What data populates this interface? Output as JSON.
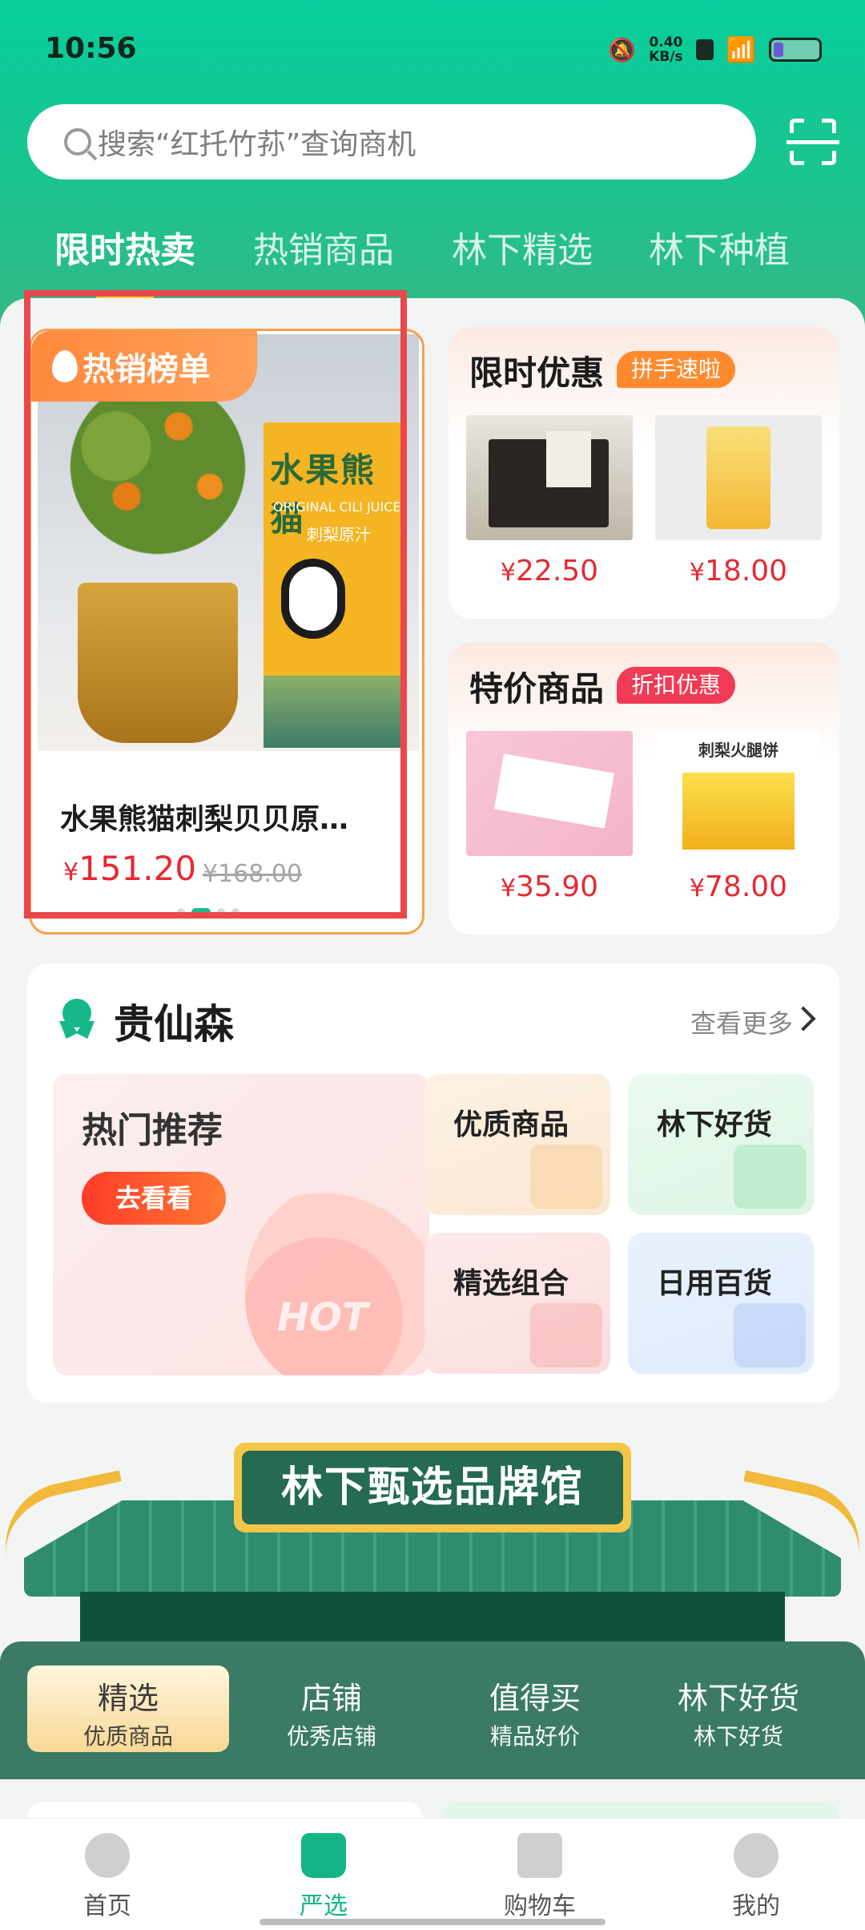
{
  "status_bar": {
    "time": "10:56",
    "speed_value": "0.40",
    "speed_unit": "KB/s"
  },
  "search": {
    "placeholder": "搜索“红托竹荪”查询商机"
  },
  "tabs": [
    {
      "label": "限时热卖",
      "active": true
    },
    {
      "label": "热销商品",
      "active": false
    },
    {
      "label": "林下精选",
      "active": false
    },
    {
      "label": "林下种植",
      "active": false
    }
  ],
  "hot_card": {
    "ribbon": "热销榜单",
    "product_box_title": "水果熊猫",
    "product_box_subtitle": "ORIGINAL CILI JUICE",
    "product_box_subtitle2": "刺梨原汁",
    "name": "水果熊猫刺梨贝贝原…",
    "currency": "¥",
    "price": "151.20",
    "original_price": "¥168.00",
    "carousel_page": 2,
    "carousel_total": 4
  },
  "promo_limited": {
    "title": "限时优惠",
    "tag": "拼手速啦",
    "items": [
      {
        "price": "22.50"
      },
      {
        "price": "18.00"
      }
    ]
  },
  "promo_special": {
    "title": "特价商品",
    "tag": "折扣优惠",
    "items": [
      {
        "price": "35.90"
      },
      {
        "price": "78.00"
      }
    ]
  },
  "guixiansen": {
    "title": "贵仙森",
    "more": "查看更多",
    "hot_recommend": {
      "title": "热门推荐",
      "button": "去看看",
      "deco_text": "HOT"
    },
    "cells": [
      "优质商品",
      "林下好货",
      "精选组合",
      "日用百货"
    ]
  },
  "brand_hall": {
    "title": "林下甄选品牌馆",
    "items": [
      {
        "l1": "精选",
        "l2": "优质商品",
        "selected": true
      },
      {
        "l1": "店铺",
        "l2": "优秀店铺",
        "selected": false
      },
      {
        "l1": "值得买",
        "l2": "精品好价",
        "selected": false
      },
      {
        "l1": "林下好货",
        "l2": "林下好货",
        "selected": false
      }
    ]
  },
  "bottom_nav": [
    {
      "label": "首页",
      "active": false
    },
    {
      "label": "严选",
      "active": true
    },
    {
      "label": "购物车",
      "active": false
    },
    {
      "label": "我的",
      "active": false
    }
  ],
  "colors": {
    "brand_green": "#13b486",
    "price_red": "#e42a32",
    "tag_orange": "#ff8a2e",
    "tag_red": "#f13b55",
    "highlight_box": "#e9474b"
  }
}
